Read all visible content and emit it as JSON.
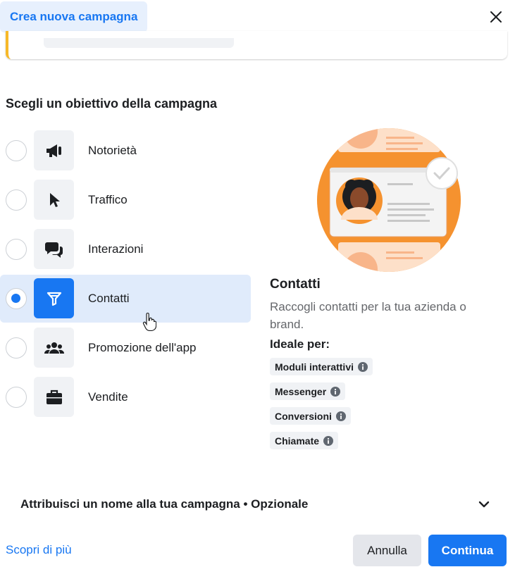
{
  "header": {
    "title": "Crea nuova campagna",
    "close_icon": "close-icon"
  },
  "section_title": "Scegli un obiettivo della campagna",
  "objectives": [
    {
      "label": "Notorietà",
      "icon": "megaphone-icon",
      "selected": false
    },
    {
      "label": "Traffico",
      "icon": "cursor-icon",
      "selected": false
    },
    {
      "label": "Interazioni",
      "icon": "chat-bubbles-icon",
      "selected": false
    },
    {
      "label": "Contatti",
      "icon": "funnel-icon",
      "selected": true
    },
    {
      "label": "Promozione dell'app",
      "icon": "people-icon",
      "selected": false
    },
    {
      "label": "Vendite",
      "icon": "briefcase-icon",
      "selected": false
    }
  ],
  "detail": {
    "title": "Contatti",
    "description": "Raccogli contatti per la tua azienda o brand.",
    "ideal_label": "Ideale per:",
    "chips": [
      "Moduli interattivi",
      "Messenger",
      "Conversioni",
      "Chiamate"
    ]
  },
  "name_section": {
    "label": "Attribuisci un nome alla tua campagna • Opzionale"
  },
  "footer": {
    "learn_more": "Scopri di più",
    "cancel": "Annulla",
    "continue": "Continua"
  },
  "colors": {
    "accent": "#1877f2",
    "selected_bg": "#e0ebfb",
    "illustration_orange": "#f5922f",
    "warning_stripe": "#f7b928"
  }
}
